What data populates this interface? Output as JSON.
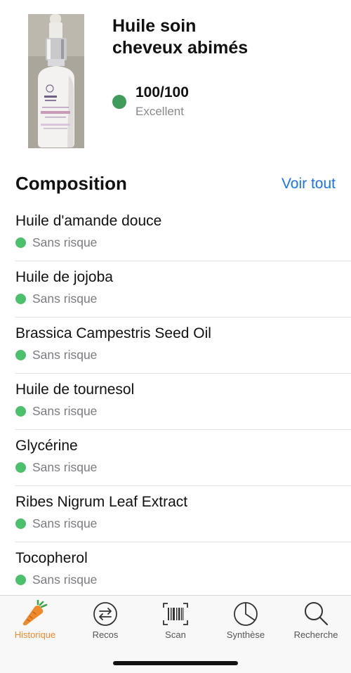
{
  "product": {
    "title_line1": "Huile soin",
    "title_line2": "cheveux abimés",
    "score": "100/100",
    "score_label": "Excellent",
    "score_color": "#3f9c5a"
  },
  "composition": {
    "title": "Composition",
    "see_all": "Voir tout",
    "items": [
      {
        "name": "Huile d'amande douce",
        "status": "Sans risque"
      },
      {
        "name": "Huile de jojoba",
        "status": "Sans risque"
      },
      {
        "name": "Brassica Campestris Seed Oil",
        "status": "Sans risque"
      },
      {
        "name": "Huile de tournesol",
        "status": "Sans risque"
      },
      {
        "name": "Glycérine",
        "status": "Sans risque"
      },
      {
        "name": "Ribes Nigrum Leaf Extract",
        "status": "Sans risque"
      },
      {
        "name": "Tocopherol",
        "status": "Sans risque"
      }
    ],
    "status_color": "#4cc06c"
  },
  "tabbar": {
    "active_color": "#ef8a2b",
    "tabs": [
      {
        "label": "Historique",
        "icon": "carrot-icon",
        "active": true
      },
      {
        "label": "Recos",
        "icon": "swap-arrows-icon",
        "active": false
      },
      {
        "label": "Scan",
        "icon": "barcode-icon",
        "active": false
      },
      {
        "label": "Synthèse",
        "icon": "pie-chart-icon",
        "active": false
      },
      {
        "label": "Recherche",
        "icon": "magnifier-icon",
        "active": false
      }
    ]
  }
}
